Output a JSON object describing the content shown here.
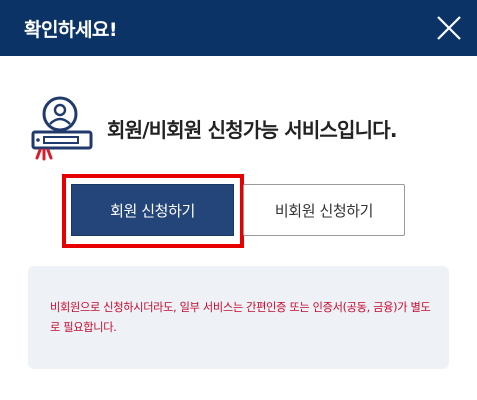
{
  "header": {
    "title": "확인하세요!",
    "close_icon": "close-icon"
  },
  "intro": {
    "icon": "member-card-icon",
    "message": "회원/비회원 신청가능 서비스입니다."
  },
  "buttons": {
    "member_label": "회원 신청하기",
    "guest_label": "비회원 신청하기"
  },
  "notice": {
    "text": "비회원으로 신청하시더라도, 일부 서비스는 간편인증 또는 인증서(공동, 금융)가 별도로 필요합니다."
  },
  "colors": {
    "header_bg": "#0b3366",
    "primary_button": "#24457a",
    "highlight_border": "#e60000",
    "notice_text": "#c40b2e",
    "notice_bg": "#eef2f7"
  }
}
